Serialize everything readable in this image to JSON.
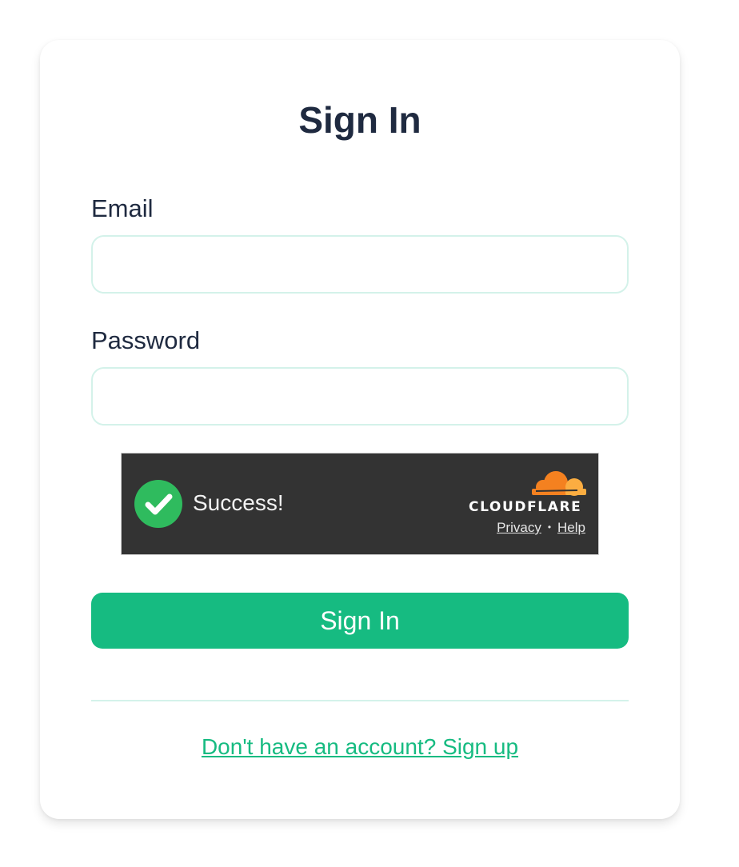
{
  "form": {
    "title": "Sign In",
    "email_label": "Email",
    "email_value": "",
    "password_label": "Password",
    "password_value": ""
  },
  "captcha": {
    "status_text": "Success!",
    "provider": "CLOUDFLARE",
    "privacy_label": "Privacy",
    "separator": "•",
    "help_label": "Help",
    "status_color": "#2fbb5e",
    "background_color": "#333333",
    "brand_color": "#f48120"
  },
  "actions": {
    "submit_label": "Sign In",
    "signup_link": "Don't have an account? Sign up",
    "accent_color": "#16bb81"
  },
  "icons": {
    "status": "checkmark-circle-icon",
    "brand": "cloudflare-cloud-icon"
  }
}
